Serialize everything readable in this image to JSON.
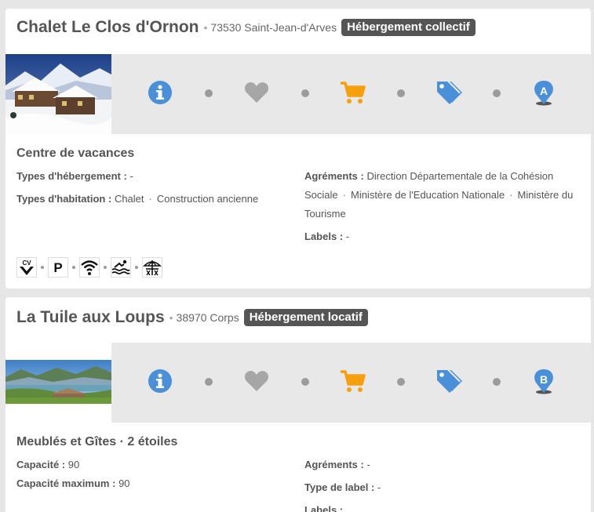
{
  "listings": [
    {
      "title": "Chalet Le Clos d'Ornon",
      "separator": "•",
      "location": "73530 Saint-Jean-d'Arves",
      "badge": "Hébergement collectif",
      "map_marker_letter": "A",
      "section_title": "Centre de vacances",
      "types_hebergement_label": "Types d'hébergement :",
      "types_hebergement_value": "-",
      "types_habitation_label": "Types d'habitation :",
      "types_habitation_values": [
        "Chalet",
        "Construction ancienne"
      ],
      "agrements_label": "Agréments :",
      "agrements_values": [
        "Direction Départementale de la Cohésion Sociale",
        "Ministère de l'Education Nationale",
        "Ministère du Tourisme"
      ],
      "labels_label": "Labels :",
      "labels_value": "-",
      "value_separator": "·",
      "facility_icons": [
        "cv-cheque-vacances-icon",
        "parking-icon",
        "wifi-icon",
        "swimming-pool-icon",
        "table-umbrella-icon"
      ],
      "parking_glyph": "P",
      "cv_glyph": "CV"
    },
    {
      "title": "La Tuile aux Loups",
      "separator": "•",
      "location": "38970 Corps",
      "badge": "Hébergement locatif",
      "map_marker_letter": "B",
      "section_title": "Meublés et Gîtes · 2 étoiles",
      "capacite_label": "Capacité :",
      "capacite_value": "90",
      "capacite_max_label": "Capacité maximum :",
      "capacite_max_value": "90",
      "agrements_label": "Agréments :",
      "agrements_value": "-",
      "type_label_label": "Type de label :",
      "type_label_value": "-",
      "labels_label": "Labels :"
    }
  ],
  "action_icons": [
    "info-icon",
    "heart-icon",
    "cart-icon",
    "tags-icon",
    "map-marker-icon"
  ],
  "colors": {
    "info_blue": "#4a90d9",
    "heart_grey": "#9b9b9b",
    "cart_orange": "#f5a00c",
    "badge_bg": "#555555"
  }
}
